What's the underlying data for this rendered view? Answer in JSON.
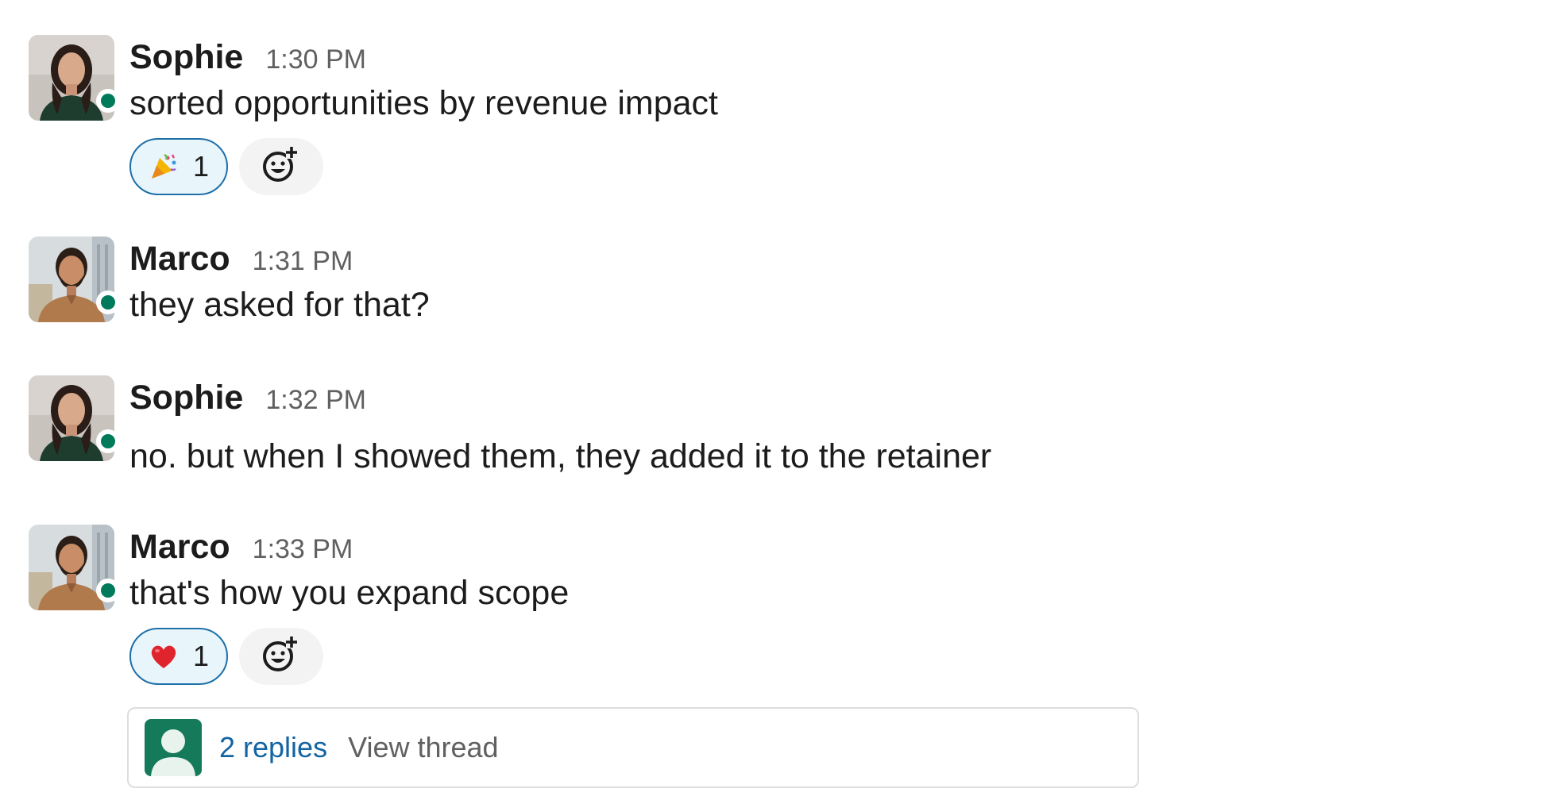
{
  "messages": [
    {
      "author": "Sophie",
      "time": "1:30 PM",
      "text": "sorted opportunities by revenue impact",
      "avatar": "sophie-avatar",
      "presence": "online",
      "reactions": [
        {
          "emoji": "party-popper-icon",
          "count": "1"
        }
      ]
    },
    {
      "author": "Marco",
      "time": "1:31 PM",
      "text": "they asked for that?",
      "avatar": "marco-avatar",
      "presence": "online"
    },
    {
      "author": "Sophie",
      "time": "1:32 PM",
      "text": "no. but when I showed them, they added it to the retainer",
      "avatar": "sophie-avatar",
      "presence": "online"
    },
    {
      "author": "Marco",
      "time": "1:33 PM",
      "text": "that's how you expand scope",
      "avatar": "marco-avatar",
      "presence": "online",
      "reactions": [
        {
          "emoji": "red-heart-icon",
          "count": "1"
        }
      ],
      "thread": {
        "replies": "2 replies",
        "view_label": "View thread"
      }
    }
  ],
  "icons": {
    "add_reaction": "add-reaction-icon",
    "thread_avatar": "user-placeholder-icon"
  },
  "colors": {
    "presence_online": "#007a5a",
    "reaction_border": "#1d6fa8",
    "reaction_bg": "#e8f5fa",
    "link": "#1264a3",
    "timestamp": "#616061"
  }
}
